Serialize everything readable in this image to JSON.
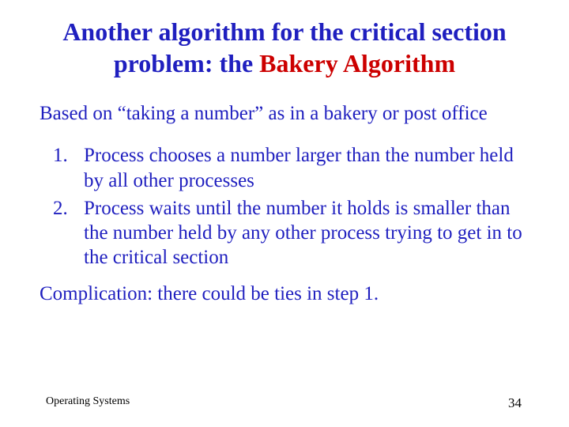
{
  "title": {
    "prefix": "Another algorithm for the critical section problem: the ",
    "highlight": "Bakery Algorithm"
  },
  "intro": "Based on “taking a number” as in a bakery or post office",
  "steps": [
    "Process chooses a number larger than the number held by all other processes",
    "Process waits until the number it holds is smaller than the number held by any other process trying to get in to the critical section"
  ],
  "complication": "Complication: there could be ties in step 1.",
  "footer": {
    "course": "Operating Systems",
    "page": "34"
  }
}
